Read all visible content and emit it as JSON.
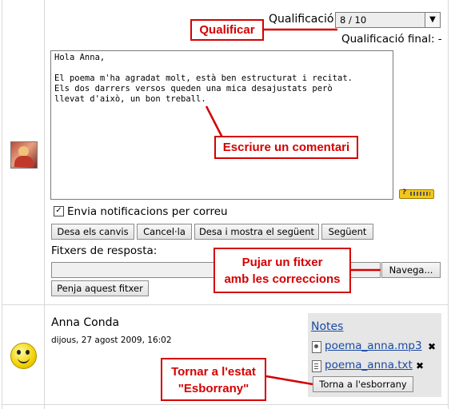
{
  "grading": {
    "label": "Qualificació",
    "selected": "8 / 10",
    "final_label": "Qualificació final: -"
  },
  "comment": {
    "text": "Hola Anna,\n\nEl poema m'ha agradat molt, està ben estructurat i recitat.\nEls dos darrers versos queden una mica desajustats però\nllevat d'això, un bon treball."
  },
  "notify": {
    "label": "Envia notificacions per correu",
    "checked": true
  },
  "buttons": {
    "save_all": "Desa els canvis",
    "cancel": "Cancel·la",
    "save_next": "Desa i mostra el següent",
    "next": "Següent",
    "browse": "Navega...",
    "upload": "Penja aquest fitxer",
    "revert_draft": "Torna a l'esborrany"
  },
  "response_files": {
    "label": "Fitxers de resposta:"
  },
  "student": {
    "name": "Anna Conda",
    "date": "dijous, 27 agost 2009, 16:02"
  },
  "notes": {
    "title": "Notes",
    "files": [
      "poema_anna.mp3",
      "poema_anna.txt"
    ],
    "delete_symbol": "✖"
  },
  "callouts": {
    "grade": "Qualificar",
    "comment": "Escriure un comentari",
    "upload_line1": "Pujar un fitxer",
    "upload_line2": "amb les correccions",
    "revert_line1": "Tornar a l'estat",
    "revert_line2": "\"Esborrany\""
  },
  "colors": {
    "callout_red": "#d40000",
    "link_blue": "#1a4aa5",
    "notes_bg": "#e6e6e6"
  }
}
